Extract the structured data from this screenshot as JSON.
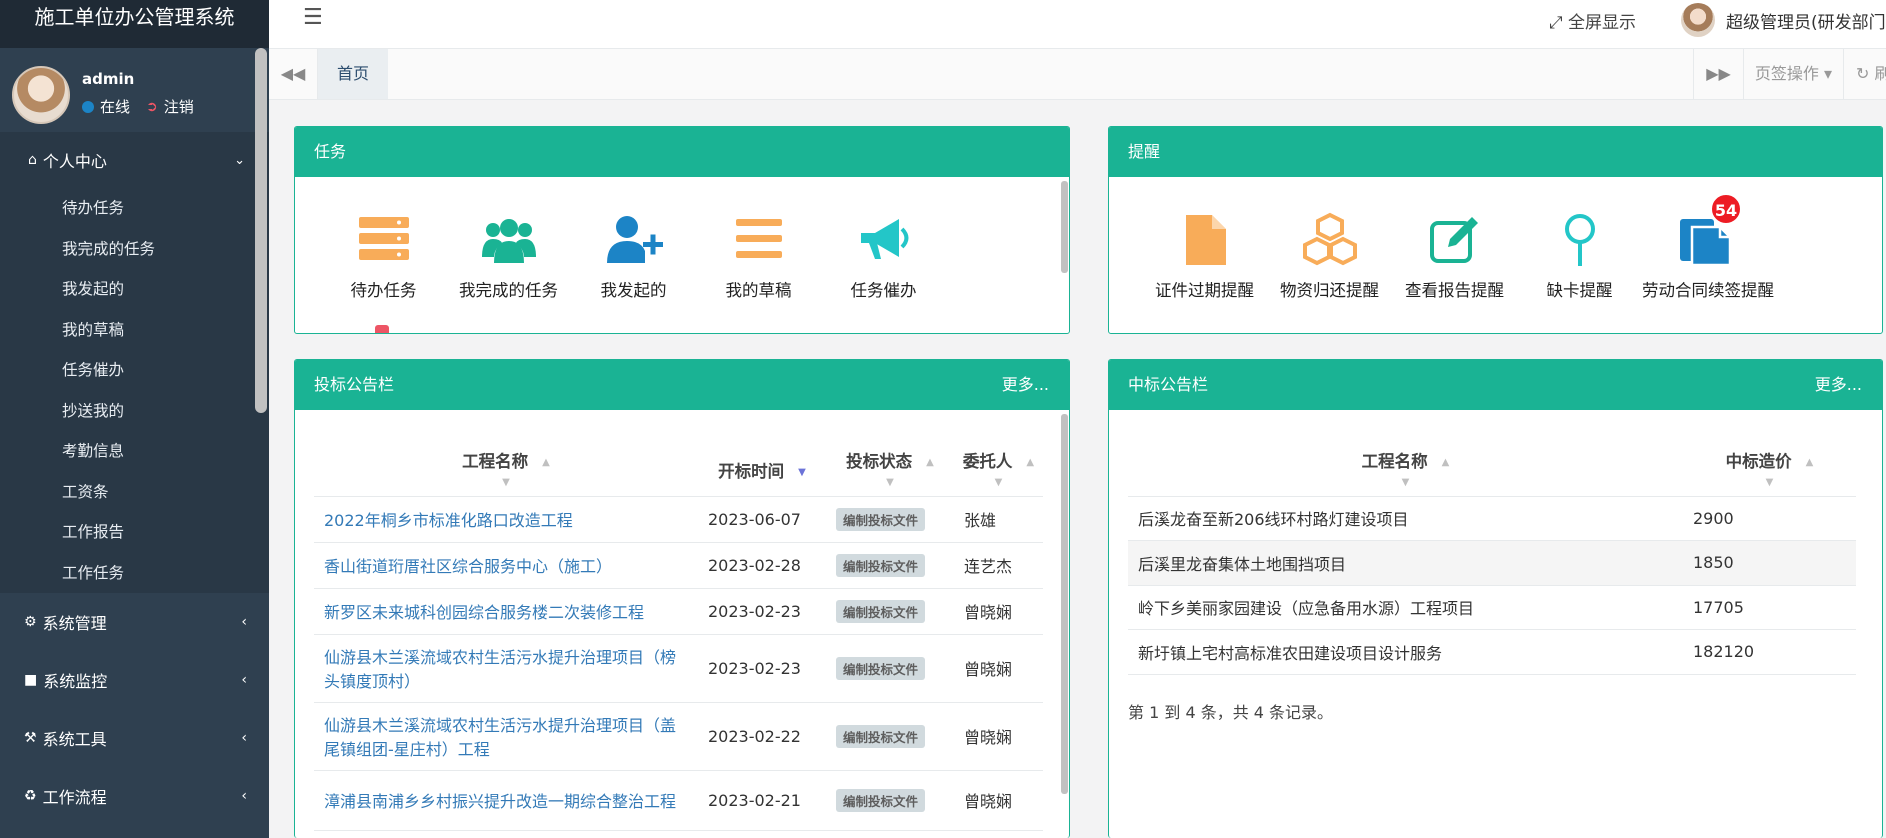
{
  "app": {
    "title": "施工单位办公管理系统"
  },
  "user": {
    "name": "admin",
    "status": "在线",
    "logout": "注销",
    "display_name": "超级管理员(研发部门)"
  },
  "header": {
    "fullscreen": "全屏显示"
  },
  "tabs": {
    "home": "首页",
    "page_ops": "页签操作",
    "refresh": "刷新"
  },
  "sidebar": {
    "personal": {
      "label": "个人中心",
      "items": [
        "待办任务",
        "我完成的任务",
        "我发起的",
        "我的草稿",
        "任务催办",
        "抄送我的",
        "考勤信息",
        "工资条",
        "工作报告",
        "工作任务"
      ]
    },
    "menus": [
      "系统管理",
      "系统监控",
      "系统工具",
      "工作流程"
    ]
  },
  "tasks": {
    "title": "任务",
    "items": [
      {
        "label": "待办任务",
        "icon": "server-icon",
        "color": "#f8ac59"
      },
      {
        "label": "我完成的任务",
        "icon": "users-icon",
        "color": "#1ab394"
      },
      {
        "label": "我发起的",
        "icon": "user-plus-icon",
        "color": "#1c84c6"
      },
      {
        "label": "我的草稿",
        "icon": "bars-icon",
        "color": "#f8ac59"
      },
      {
        "label": "任务催办",
        "icon": "bullhorn-icon",
        "color": "#23c6c8"
      }
    ]
  },
  "reminders": {
    "title": "提醒",
    "items": [
      {
        "label": "证件过期提醒",
        "icon": "file-icon",
        "color": "#f8ac59"
      },
      {
        "label": "物资归还提醒",
        "icon": "cubes-icon",
        "color": "#f8ac59"
      },
      {
        "label": "查看报告提醒",
        "icon": "edit-icon",
        "color": "#1ab394"
      },
      {
        "label": "缺卡提醒",
        "icon": "map-pin-icon",
        "color": "#23c6c8"
      },
      {
        "label": "劳动合同续签提醒",
        "icon": "files-icon",
        "color": "#1c84c6",
        "badge": "54"
      }
    ]
  },
  "bids": {
    "title": "投标公告栏",
    "more": "更多...",
    "columns": [
      "工程名称",
      "开标时间",
      "投标状态",
      "委托人"
    ],
    "rows": [
      {
        "name": "2022年桐乡市标准化路口改造工程",
        "date": "2023-06-07",
        "status": "编制投标文件",
        "agent": "张雄"
      },
      {
        "name": "香山街道珩厝社区综合服务中心（施工）",
        "date": "2023-02-28",
        "status": "编制投标文件",
        "agent": "连艺杰"
      },
      {
        "name": "新罗区未来城科创园综合服务楼二次装修工程",
        "date": "2023-02-23",
        "status": "编制投标文件",
        "agent": "曾晓娴"
      },
      {
        "name": "仙游县木兰溪流域农村生活污水提升治理项目（榜头镇度顶村）",
        "date": "2023-02-23",
        "status": "编制投标文件",
        "agent": "曾晓娴"
      },
      {
        "name": "仙游县木兰溪流域农村生活污水提升治理项目（盖尾镇组团-星庄村）工程",
        "date": "2023-02-22",
        "status": "编制投标文件",
        "agent": "曾晓娴"
      },
      {
        "name": "漳浦县南浦乡乡村振兴提升改造一期综合整治工程",
        "date": "2023-02-21",
        "status": "编制投标文件",
        "agent": "曾晓娴"
      }
    ]
  },
  "wins": {
    "title": "中标公告栏",
    "more": "更多...",
    "columns": [
      "工程名称",
      "中标造价"
    ],
    "rows": [
      {
        "name": "后溪龙奋至新206线环村路灯建设项目",
        "price": "2900"
      },
      {
        "name": "后溪里龙奋集体土地围挡项目",
        "price": "1850"
      },
      {
        "name": "岭下乡美丽家园建设（应急备用水源）工程项目",
        "price": "17705"
      },
      {
        "name": "新圩镇上宅村高标准农田建设项目设计服务",
        "price": "182120"
      }
    ],
    "pageinfo": "第 1 到 4 条，共 4 条记录。"
  }
}
